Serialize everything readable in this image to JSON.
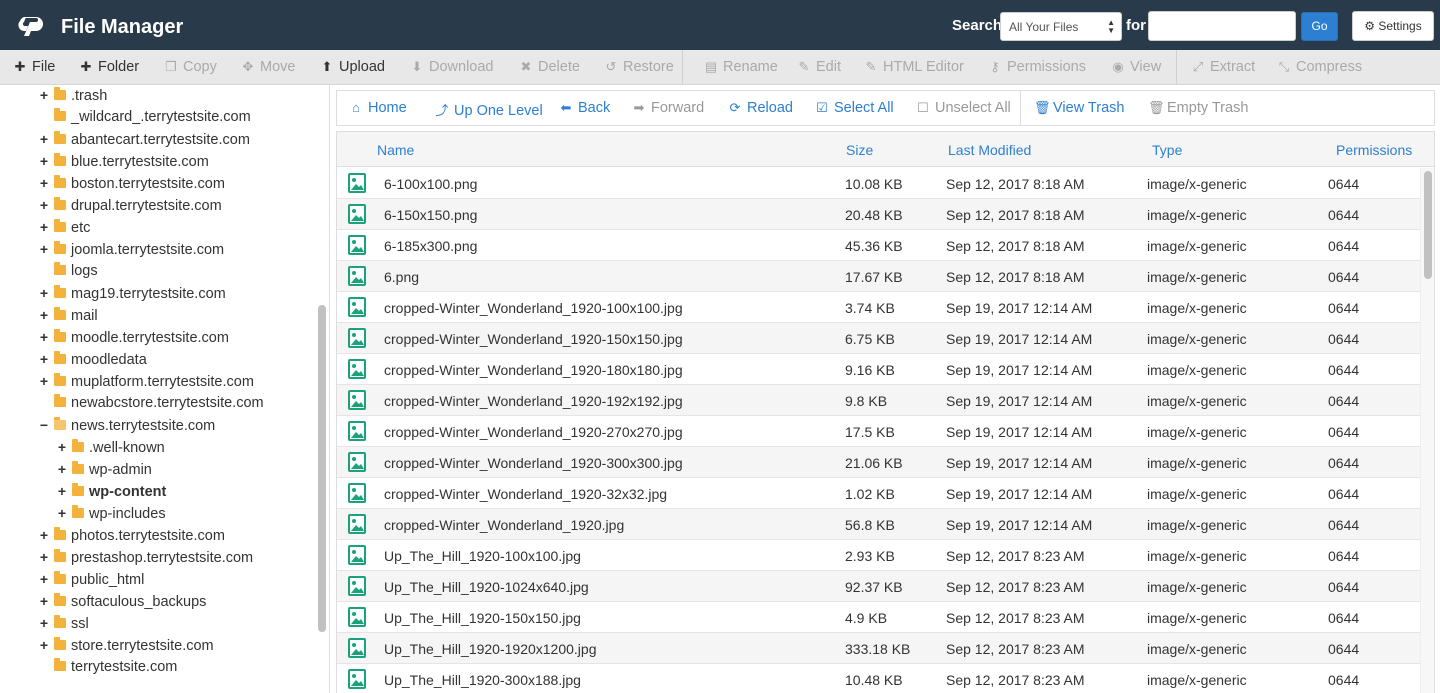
{
  "header": {
    "title": "File Manager",
    "search_label": "Search",
    "search_scope": "All Your Files",
    "for_label": "for",
    "search_value": "",
    "go_label": "Go",
    "settings_label": "Settings"
  },
  "toolbar": {
    "items": [
      {
        "label": "File",
        "icon": "plus-icon",
        "enabled": true
      },
      {
        "label": "Folder",
        "icon": "plus-icon",
        "enabled": true
      },
      {
        "label": "Copy",
        "icon": "copy-icon",
        "enabled": false
      },
      {
        "label": "Move",
        "icon": "move-icon",
        "enabled": false
      },
      {
        "label": "Upload",
        "icon": "upload-icon",
        "enabled": true
      },
      {
        "label": "Download",
        "icon": "download-icon",
        "enabled": false
      },
      {
        "label": "Delete",
        "icon": "delete-icon",
        "enabled": false
      },
      {
        "label": "Restore",
        "icon": "restore-icon",
        "enabled": false
      },
      {
        "label": "Rename",
        "icon": "rename-icon",
        "enabled": false
      },
      {
        "label": "Edit",
        "icon": "edit-icon",
        "enabled": false
      },
      {
        "label": "HTML Editor",
        "icon": "html-editor-icon",
        "enabled": false
      },
      {
        "label": "Permissions",
        "icon": "key-icon",
        "enabled": false
      },
      {
        "label": "View",
        "icon": "eye-icon",
        "enabled": false
      },
      {
        "label": "Extract",
        "icon": "extract-icon",
        "enabled": false
      },
      {
        "label": "Compress",
        "icon": "compress-icon",
        "enabled": false
      }
    ]
  },
  "sidebar": {
    "items": [
      {
        "label": ".trash",
        "level": 0,
        "toggle": "+",
        "open": false,
        "bold": false
      },
      {
        "label": "_wildcard_.terrytestsite.com",
        "level": 0,
        "toggle": "",
        "open": false,
        "bold": false
      },
      {
        "label": "abantecart.terrytestsite.com",
        "level": 0,
        "toggle": "+",
        "open": false,
        "bold": false
      },
      {
        "label": "blue.terrytestsite.com",
        "level": 0,
        "toggle": "+",
        "open": false,
        "bold": false
      },
      {
        "label": "boston.terrytestsite.com",
        "level": 0,
        "toggle": "+",
        "open": false,
        "bold": false
      },
      {
        "label": "drupal.terrytestsite.com",
        "level": 0,
        "toggle": "+",
        "open": false,
        "bold": false
      },
      {
        "label": "etc",
        "level": 0,
        "toggle": "+",
        "open": false,
        "bold": false
      },
      {
        "label": "joomla.terrytestsite.com",
        "level": 0,
        "toggle": "+",
        "open": false,
        "bold": false
      },
      {
        "label": "logs",
        "level": 0,
        "toggle": "",
        "open": false,
        "bold": false
      },
      {
        "label": "mag19.terrytestsite.com",
        "level": 0,
        "toggle": "+",
        "open": false,
        "bold": false
      },
      {
        "label": "mail",
        "level": 0,
        "toggle": "+",
        "open": false,
        "bold": false
      },
      {
        "label": "moodle.terrytestsite.com",
        "level": 0,
        "toggle": "+",
        "open": false,
        "bold": false
      },
      {
        "label": "moodledata",
        "level": 0,
        "toggle": "+",
        "open": false,
        "bold": false
      },
      {
        "label": "muplatform.terrytestsite.com",
        "level": 0,
        "toggle": "+",
        "open": false,
        "bold": false
      },
      {
        "label": "newabcstore.terrytestsite.com",
        "level": 0,
        "toggle": "",
        "open": false,
        "bold": false
      },
      {
        "label": "news.terrytestsite.com",
        "level": 0,
        "toggle": "−",
        "open": true,
        "bold": false
      },
      {
        "label": ".well-known",
        "level": 1,
        "toggle": "+",
        "open": false,
        "bold": false
      },
      {
        "label": "wp-admin",
        "level": 1,
        "toggle": "+",
        "open": false,
        "bold": false
      },
      {
        "label": "wp-content",
        "level": 1,
        "toggle": "+",
        "open": false,
        "bold": true
      },
      {
        "label": "wp-includes",
        "level": 1,
        "toggle": "+",
        "open": false,
        "bold": false
      },
      {
        "label": "photos.terrytestsite.com",
        "level": 0,
        "toggle": "+",
        "open": false,
        "bold": false
      },
      {
        "label": "prestashop.terrytestsite.com",
        "level": 0,
        "toggle": "+",
        "open": false,
        "bold": false
      },
      {
        "label": "public_html",
        "level": 0,
        "toggle": "+",
        "open": false,
        "bold": false
      },
      {
        "label": "softaculous_backups",
        "level": 0,
        "toggle": "+",
        "open": false,
        "bold": false
      },
      {
        "label": "ssl",
        "level": 0,
        "toggle": "+",
        "open": false,
        "bold": false
      },
      {
        "label": "store.terrytestsite.com",
        "level": 0,
        "toggle": "+",
        "open": false,
        "bold": false
      },
      {
        "label": "terrytestsite.com",
        "level": 0,
        "toggle": "",
        "open": false,
        "bold": false
      }
    ]
  },
  "nav": {
    "items": [
      {
        "label": "Home",
        "icon": "home-icon",
        "enabled": true
      },
      {
        "label": "Up One Level",
        "icon": "level-up-icon",
        "enabled": true
      },
      {
        "label": "Back",
        "icon": "arrow-left-icon",
        "enabled": true
      },
      {
        "label": "Forward",
        "icon": "arrow-right-icon",
        "enabled": false
      },
      {
        "label": "Reload",
        "icon": "reload-icon",
        "enabled": true
      },
      {
        "label": "Select All",
        "icon": "checkbox-checked-icon",
        "enabled": true
      },
      {
        "label": "Unselect All",
        "icon": "checkbox-empty-icon",
        "enabled": false
      },
      {
        "label": "View Trash",
        "icon": "trash-icon",
        "enabled": true
      },
      {
        "label": "Empty Trash",
        "icon": "trash-icon",
        "enabled": false
      }
    ]
  },
  "table": {
    "columns": [
      "Name",
      "Size",
      "Last Modified",
      "Type",
      "Permissions"
    ],
    "rows": [
      {
        "name": "6-100x100.png",
        "size": "10.08 KB",
        "modified": "Sep 12, 2017 8:18 AM",
        "type": "image/x-generic",
        "perms": "0644"
      },
      {
        "name": "6-150x150.png",
        "size": "20.48 KB",
        "modified": "Sep 12, 2017 8:18 AM",
        "type": "image/x-generic",
        "perms": "0644"
      },
      {
        "name": "6-185x300.png",
        "size": "45.36 KB",
        "modified": "Sep 12, 2017 8:18 AM",
        "type": "image/x-generic",
        "perms": "0644"
      },
      {
        "name": "6.png",
        "size": "17.67 KB",
        "modified": "Sep 12, 2017 8:18 AM",
        "type": "image/x-generic",
        "perms": "0644"
      },
      {
        "name": "cropped-Winter_Wonderland_1920-100x100.jpg",
        "size": "3.74 KB",
        "modified": "Sep 19, 2017 12:14 AM",
        "type": "image/x-generic",
        "perms": "0644"
      },
      {
        "name": "cropped-Winter_Wonderland_1920-150x150.jpg",
        "size": "6.75 KB",
        "modified": "Sep 19, 2017 12:14 AM",
        "type": "image/x-generic",
        "perms": "0644"
      },
      {
        "name": "cropped-Winter_Wonderland_1920-180x180.jpg",
        "size": "9.16 KB",
        "modified": "Sep 19, 2017 12:14 AM",
        "type": "image/x-generic",
        "perms": "0644"
      },
      {
        "name": "cropped-Winter_Wonderland_1920-192x192.jpg",
        "size": "9.8 KB",
        "modified": "Sep 19, 2017 12:14 AM",
        "type": "image/x-generic",
        "perms": "0644"
      },
      {
        "name": "cropped-Winter_Wonderland_1920-270x270.jpg",
        "size": "17.5 KB",
        "modified": "Sep 19, 2017 12:14 AM",
        "type": "image/x-generic",
        "perms": "0644"
      },
      {
        "name": "cropped-Winter_Wonderland_1920-300x300.jpg",
        "size": "21.06 KB",
        "modified": "Sep 19, 2017 12:14 AM",
        "type": "image/x-generic",
        "perms": "0644"
      },
      {
        "name": "cropped-Winter_Wonderland_1920-32x32.jpg",
        "size": "1.02 KB",
        "modified": "Sep 19, 2017 12:14 AM",
        "type": "image/x-generic",
        "perms": "0644"
      },
      {
        "name": "cropped-Winter_Wonderland_1920.jpg",
        "size": "56.8 KB",
        "modified": "Sep 19, 2017 12:14 AM",
        "type": "image/x-generic",
        "perms": "0644"
      },
      {
        "name": "Up_The_Hill_1920-100x100.jpg",
        "size": "2.93 KB",
        "modified": "Sep 12, 2017 8:23 AM",
        "type": "image/x-generic",
        "perms": "0644"
      },
      {
        "name": "Up_The_Hill_1920-1024x640.jpg",
        "size": "92.37 KB",
        "modified": "Sep 12, 2017 8:23 AM",
        "type": "image/x-generic",
        "perms": "0644"
      },
      {
        "name": "Up_The_Hill_1920-150x150.jpg",
        "size": "4.9 KB",
        "modified": "Sep 12, 2017 8:23 AM",
        "type": "image/x-generic",
        "perms": "0644"
      },
      {
        "name": "Up_The_Hill_1920-1920x1200.jpg",
        "size": "333.18 KB",
        "modified": "Sep 12, 2017 8:23 AM",
        "type": "image/x-generic",
        "perms": "0644"
      },
      {
        "name": "Up_The_Hill_1920-300x188.jpg",
        "size": "10.48 KB",
        "modified": "Sep 12, 2017 8:23 AM",
        "type": "image/x-generic",
        "perms": "0644"
      }
    ]
  },
  "colors": {
    "header_bg": "#293a4a",
    "accent": "#2d7fd1",
    "folder": "#f3b23c",
    "file_icon": "#1aa37a"
  }
}
